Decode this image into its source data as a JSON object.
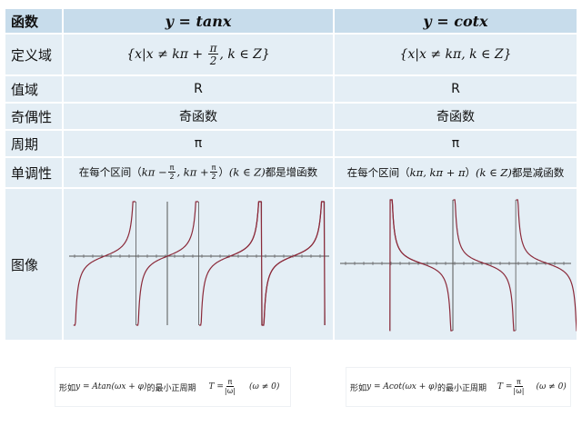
{
  "header": {
    "label": "函数",
    "col_a": "y = tanx",
    "col_b": "y = cotx"
  },
  "rows": {
    "domain": {
      "label": "定义域",
      "a_pre": "{x|x ≠ kπ + ",
      "a_num": "π",
      "a_den": "2",
      "a_post": ", k ∈ Z}",
      "b": "{x|x ≠ kπ, k ∈ Z}"
    },
    "range": {
      "label": "值域",
      "a": "R",
      "b": "R"
    },
    "parity": {
      "label": "奇偶性",
      "a": "奇函数",
      "b": "奇函数"
    },
    "period": {
      "label": "周期",
      "a": "π",
      "b": "π"
    },
    "monotonic": {
      "label": "单调性",
      "a_text1": "在每个区间（",
      "a_m1": "kπ −",
      "a_f1_num": "π",
      "a_f1_den": "2",
      "a_m2": ", kπ +",
      "a_f2_num": "π",
      "a_f2_den": "2",
      "a_text2": "）",
      "a_cond": "(k ∈ Z)",
      "a_text3": "都是增函数",
      "b_text1": "在每个区间（",
      "b_m": "kπ, kπ + π",
      "b_text2": "）",
      "b_cond": "(k ∈ Z)",
      "b_text3": "都是减函数"
    },
    "graph": {
      "label": "图像"
    }
  },
  "footer_a": {
    "text1": "形如",
    "expr": "y = Atan(ωx + φ)",
    "text2": "的最小正周期",
    "period_lhs": "T =",
    "num": "π",
    "den": "|ω|",
    "cond": "(ω ≠ 0)"
  },
  "footer_b": {
    "text1": "形如",
    "expr": "y = Acot(ωx + φ)",
    "text2": "的最小正周期",
    "period_lhs": "T =",
    "num": "π",
    "den": "|ω|",
    "cond": "(ω ≠ 0)"
  },
  "colors": {
    "header_bg": "#c7dceb",
    "cell_bg": "#e4eef5",
    "curve": "#8b2a3a",
    "axis": "#555555"
  }
}
